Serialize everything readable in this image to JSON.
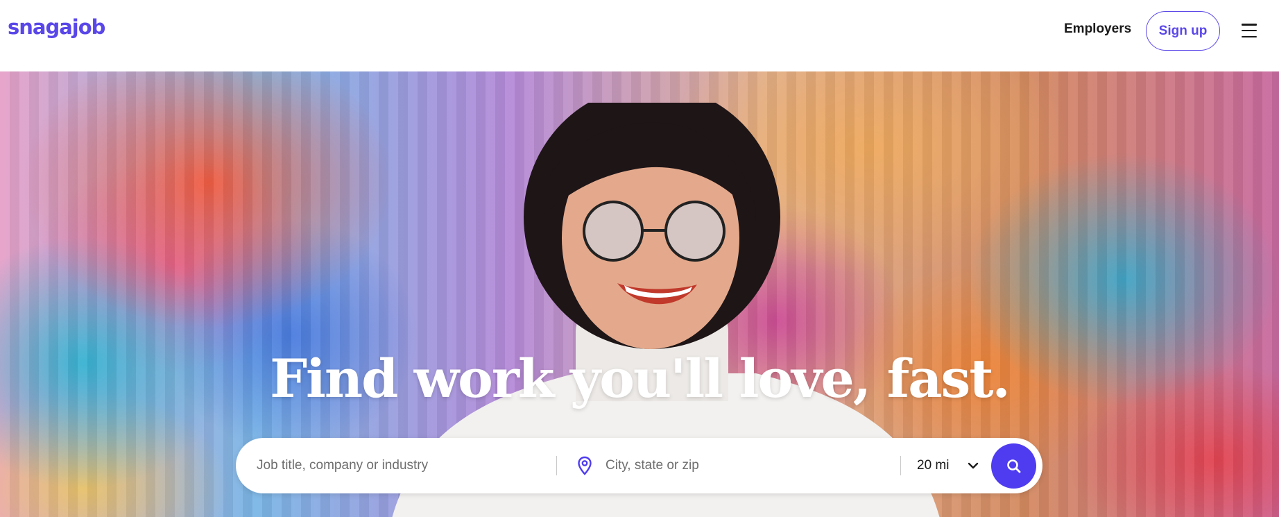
{
  "header": {
    "logo_text": "snagajob",
    "employers_label": "Employers",
    "signup_label": "Sign up",
    "menu_icon": "hamburger-menu-icon"
  },
  "hero": {
    "headline": "Find work you'll love, fast.",
    "search": {
      "job_placeholder": "Job title, company or industry",
      "location_placeholder": "City, state or zip",
      "location_icon": "map-pin-icon",
      "radius_value": "20 mi",
      "radius_icon": "chevron-down-icon",
      "submit_icon": "search-icon"
    }
  },
  "colors": {
    "brand": "#5a47e8",
    "search_button": "#4f3cf0",
    "text_dark": "#1a1a1a",
    "placeholder": "#6e6e6e"
  }
}
